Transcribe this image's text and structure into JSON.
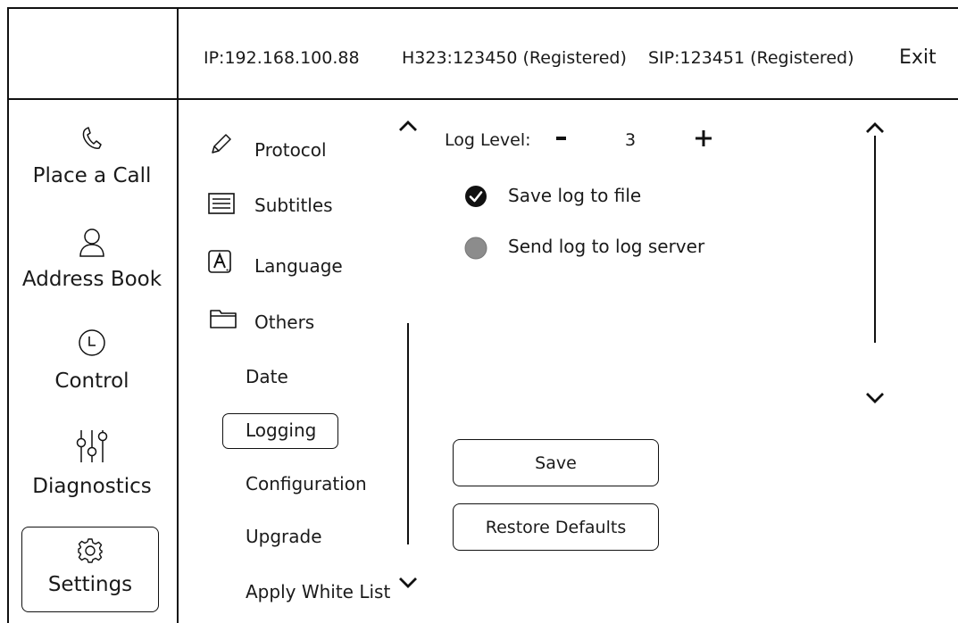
{
  "header": {
    "ip": "IP:192.168.100.88",
    "h323": "H323:123450 (Registered)",
    "sip": "SIP:123451 (Registered)",
    "exit_label": "Exit"
  },
  "sidebar": {
    "items": [
      {
        "label": "Place a Call",
        "icon": "phone-icon"
      },
      {
        "label": "Address Book",
        "icon": "person-icon"
      },
      {
        "label": "Control",
        "icon": "clock-icon"
      },
      {
        "label": "Diagnostics",
        "icon": "sliders-icon"
      },
      {
        "label": "Settings",
        "icon": "gear-icon",
        "selected": true
      }
    ]
  },
  "settings_menu": {
    "items": [
      {
        "label": "Protocol",
        "icon": "pencil-icon"
      },
      {
        "label": "Subtitles",
        "icon": "subtitles-icon"
      },
      {
        "label": "Language",
        "icon": "language-icon"
      },
      {
        "label": "Others",
        "icon": "folder-icon"
      }
    ],
    "sub_items": [
      {
        "label": "Date"
      },
      {
        "label": "Logging",
        "selected": true
      },
      {
        "label": "Configuration"
      },
      {
        "label": "Upgrade"
      },
      {
        "label": "Apply White List"
      }
    ]
  },
  "logging": {
    "log_level_label": "Log Level:",
    "minus": "-",
    "log_level_value": "3",
    "plus": "+",
    "save_to_file_label": "Save log to file",
    "save_to_file_checked": true,
    "send_to_server_label": "Send log to log server",
    "send_to_server_checked": false,
    "save_label": "Save",
    "restore_label": "Restore Defaults"
  },
  "colors": {
    "line": "#111111",
    "checked": "#111111",
    "unchecked": "#8c8c8c"
  }
}
